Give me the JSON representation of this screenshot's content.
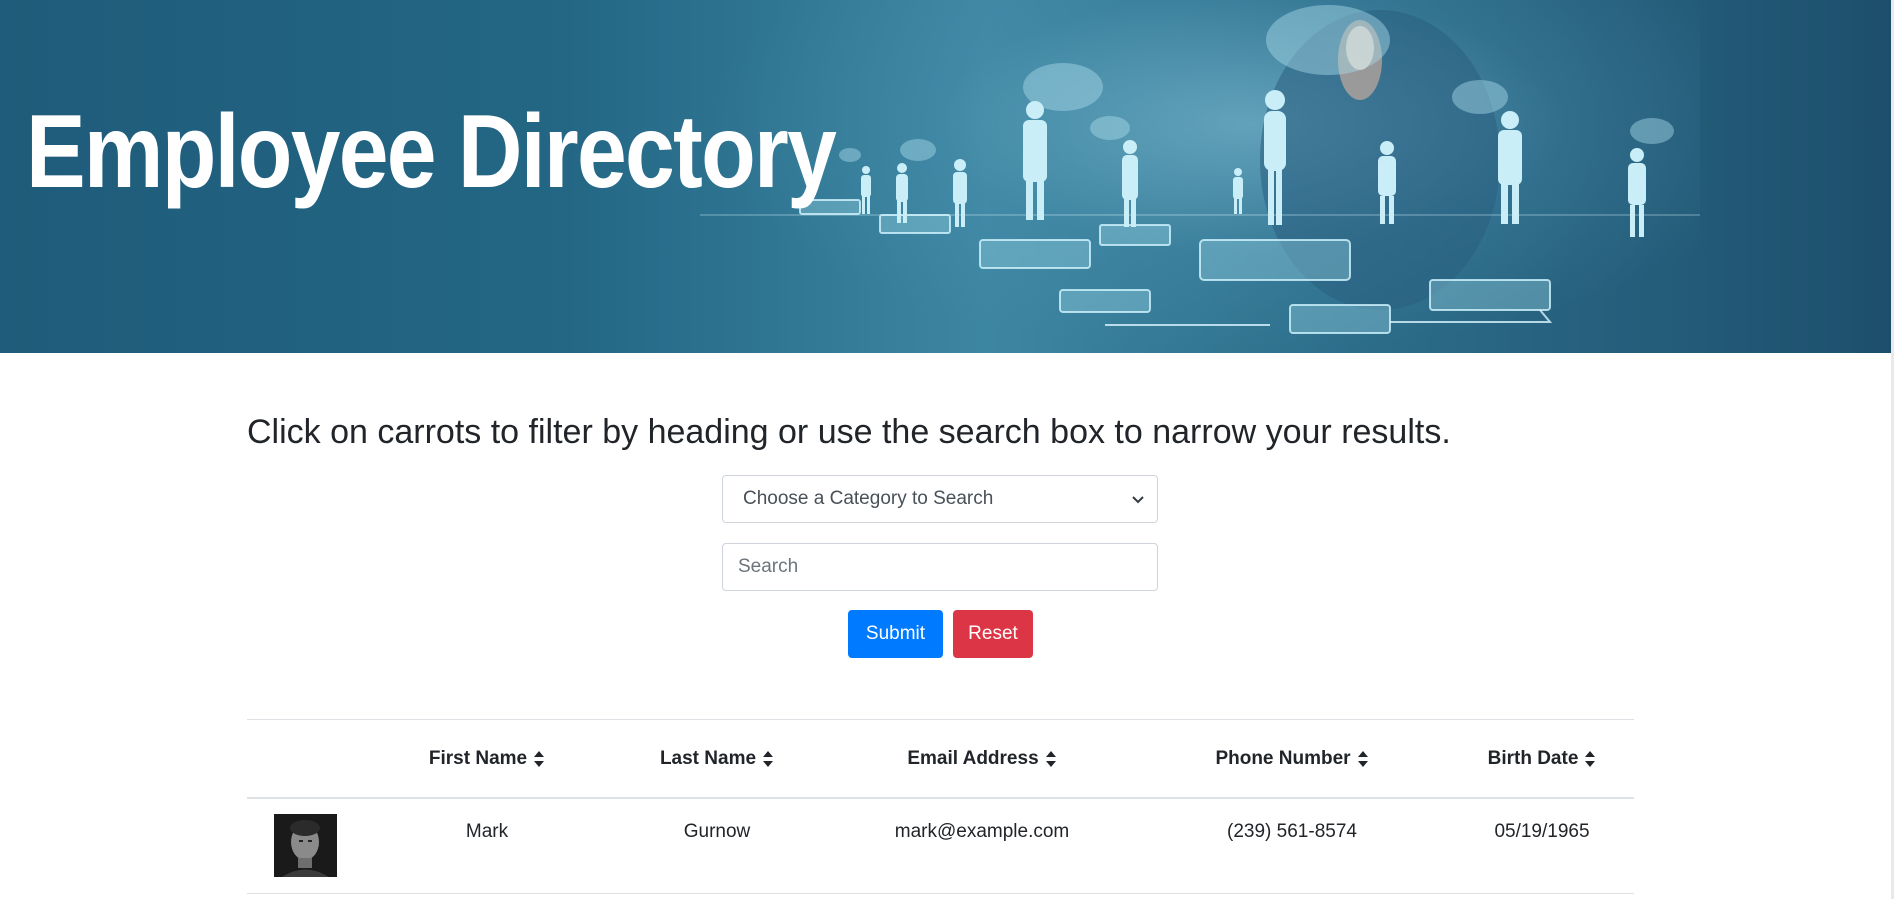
{
  "header": {
    "title": "Employee Directory"
  },
  "instructions": "Click on carrots to filter by heading or use the search box to narrow your results.",
  "search": {
    "category_selected": "Choose a Category to Search",
    "placeholder": "Search",
    "value": ""
  },
  "buttons": {
    "submit": "Submit",
    "reset": "Reset"
  },
  "colors": {
    "banner": "#236785",
    "submit": "#007bff",
    "reset": "#dc3545"
  },
  "table": {
    "columns": [
      "First Name",
      "Last Name",
      "Email Address",
      "Phone Number",
      "Birth Date"
    ],
    "sort_icon": "sort-caret-icon",
    "rows": [
      {
        "avatar": "employee-photo",
        "first_name": "Mark",
        "last_name": "Gurnow",
        "email": "mark@example.com",
        "phone": "(239) 561-8574",
        "birth_date": "05/19/1965"
      }
    ]
  }
}
